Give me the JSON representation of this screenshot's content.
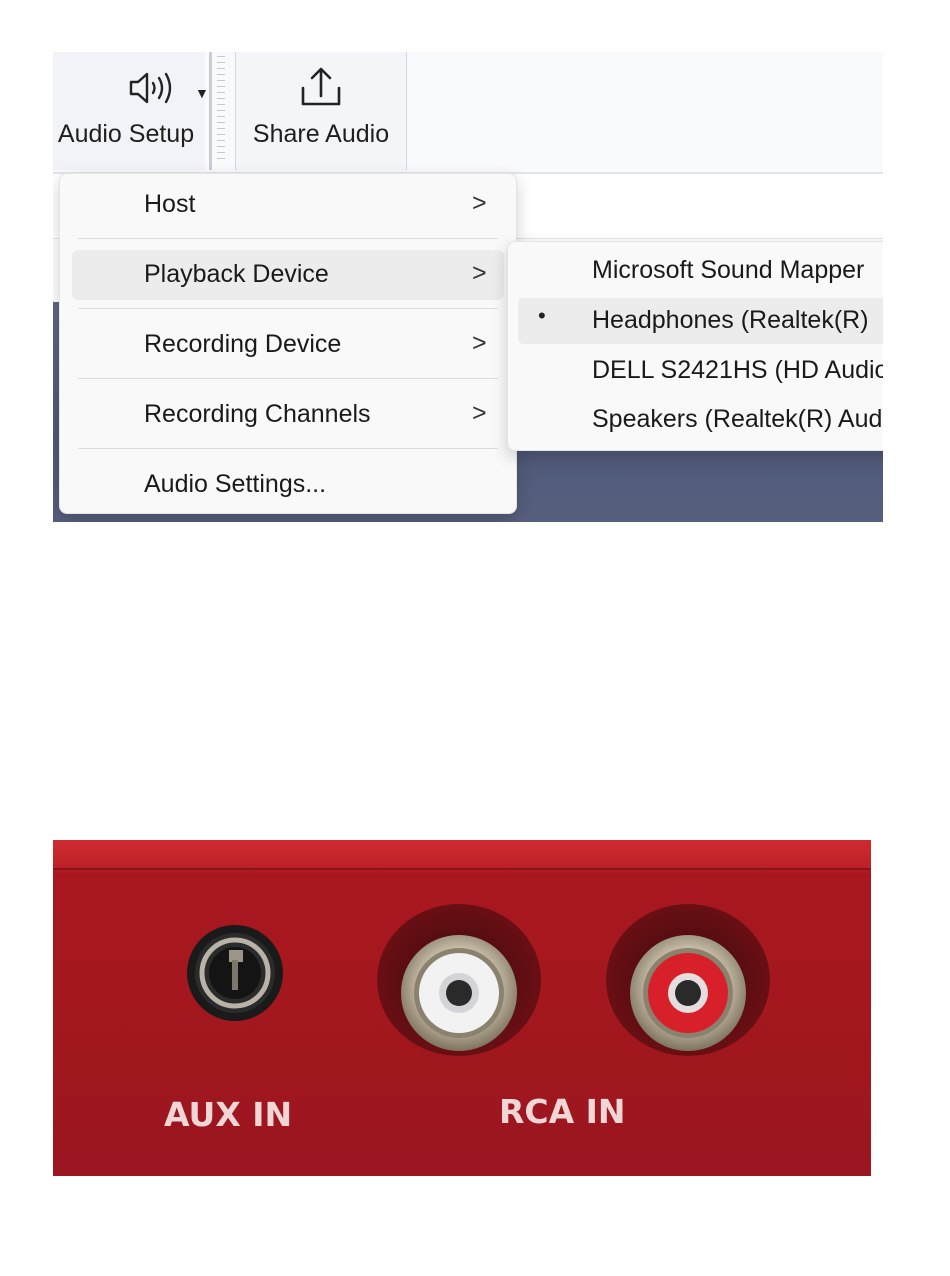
{
  "toolbar": {
    "audio_setup_label": "Audio Setup",
    "share_audio_label": "Share Audio",
    "icons": [
      "speaker-icon",
      "chevron-down-icon",
      "share-upload-icon"
    ]
  },
  "menu": {
    "items": [
      {
        "label": "Host",
        "has_submenu": true,
        "chevron": ">"
      },
      {
        "label": "Playback Device",
        "has_submenu": true,
        "chevron": ">",
        "active": true
      },
      {
        "label": "Recording Device",
        "has_submenu": true,
        "chevron": ">"
      },
      {
        "label": "Recording Channels",
        "has_submenu": true,
        "chevron": ">"
      },
      {
        "label": "Audio Settings...",
        "has_submenu": false
      }
    ]
  },
  "submenu": {
    "items": [
      {
        "label": "Microsoft Sound Mapper",
        "selected": false
      },
      {
        "label": "Headphones (Realtek(R)",
        "selected": true,
        "bullet": "•"
      },
      {
        "label": "DELL S2421HS (HD Audio",
        "selected": false
      },
      {
        "label": "Speakers (Realtek(R) Aud",
        "selected": false
      }
    ]
  },
  "photo": {
    "aux_label": "AUX IN",
    "rca_label": "RCA IN",
    "colors": {
      "panel": "#a2171e",
      "rca_left": "#f2f2f2",
      "rca_right": "#d8202a"
    }
  }
}
